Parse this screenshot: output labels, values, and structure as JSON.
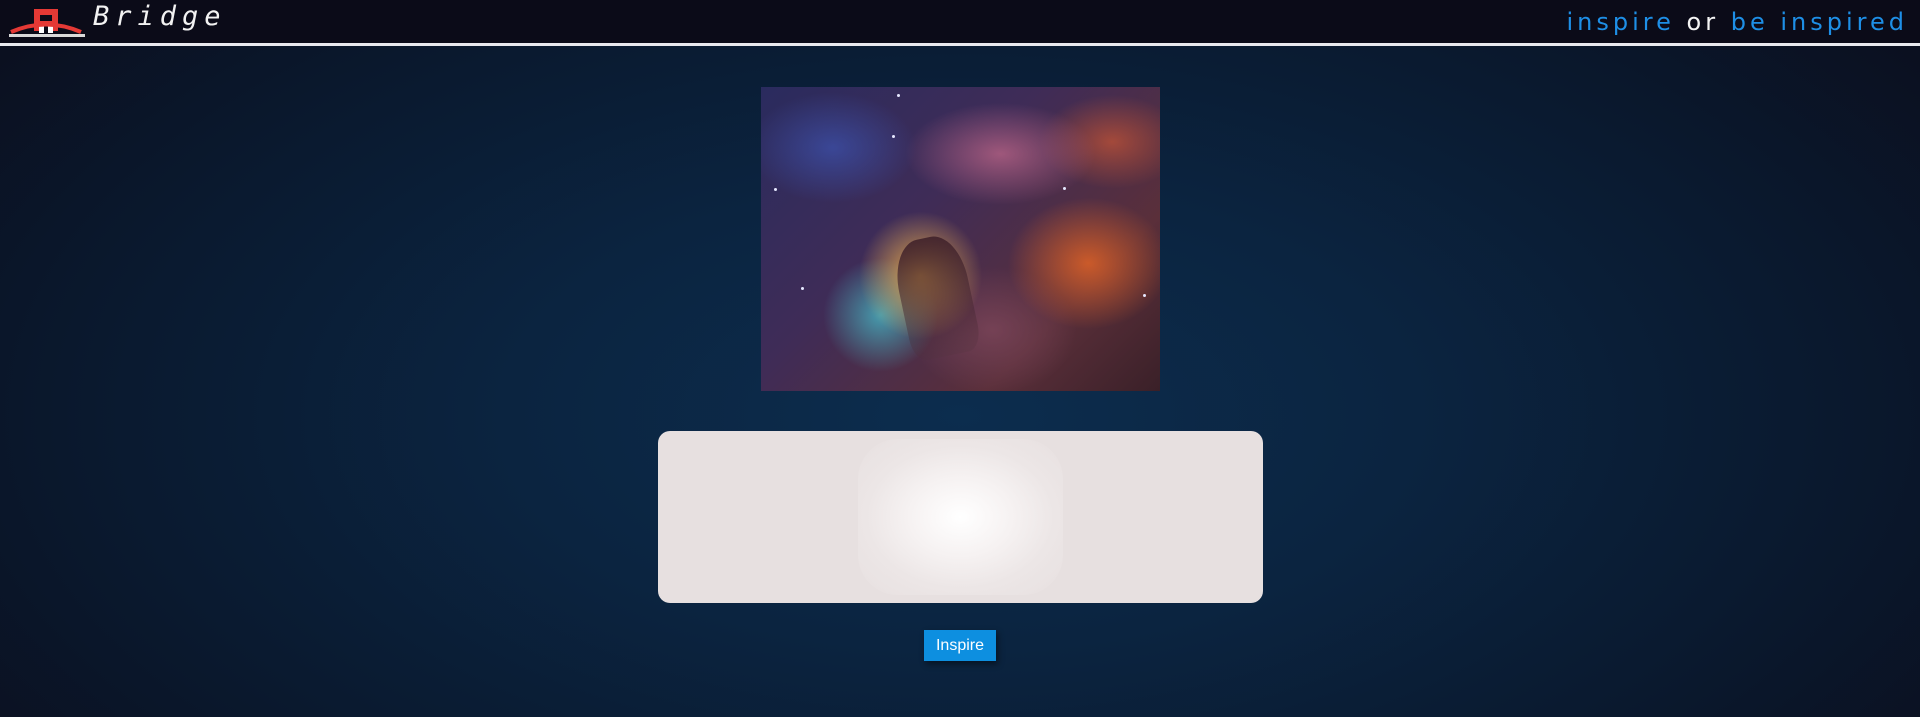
{
  "header": {
    "brand": "Bridge",
    "logo_icon": "bridge-logo-icon",
    "tagline": {
      "part1": "inspire",
      "part2": "or",
      "part3": "be inspired"
    }
  },
  "main": {
    "image_icon": "nebula-image",
    "inspire_button": "Inspire"
  },
  "colors": {
    "accent": "#1e8fe6",
    "button": "#0d8fe0",
    "logo": "#e53935",
    "card": "#e7e0e0"
  }
}
